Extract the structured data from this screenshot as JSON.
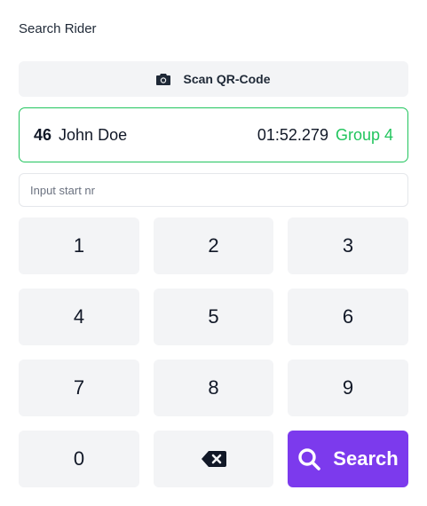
{
  "page": {
    "title": "Search Rider"
  },
  "scan": {
    "label": "Scan QR-Code",
    "icon": "camera-icon"
  },
  "rider": {
    "number": "46",
    "name": "John Doe",
    "time": "01:52.279",
    "group": "Group 4"
  },
  "start_input": {
    "placeholder": "Input start nr",
    "value": ""
  },
  "keypad": {
    "keys": [
      "1",
      "2",
      "3",
      "4",
      "5",
      "6",
      "7",
      "8",
      "9",
      "0"
    ],
    "backspace_icon": "backspace-icon",
    "search_label": "Search",
    "search_icon": "search-icon"
  },
  "colors": {
    "accent": "#7c3aed",
    "success": "#22c55e",
    "key_bg": "#f3f4f6"
  }
}
